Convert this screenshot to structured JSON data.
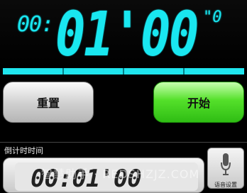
{
  "timer": {
    "hours": "00:",
    "minutes_seconds": "01'00",
    "tenths": "\"0",
    "progress_fraction": 1.0
  },
  "buttons": {
    "reset_label": "重置",
    "start_label": "开始"
  },
  "countdown_setting": {
    "title": "倒计时时间",
    "value": "00:01'00"
  },
  "voice_setting": {
    "label": "语音设置",
    "icon": "microphone-icon"
  },
  "watermark": {
    "text": "智慧助手 · REDSHZJZ.COM"
  },
  "colors": {
    "display_cyan": "#19e7f0",
    "start_green": "#54e02a"
  }
}
